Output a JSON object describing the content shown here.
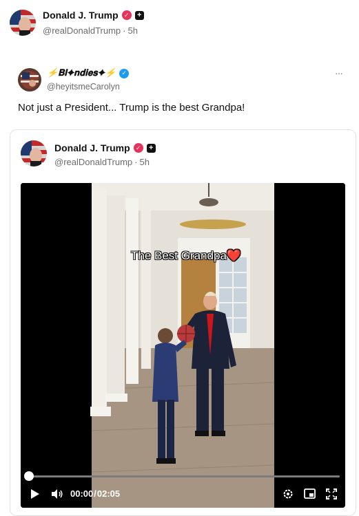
{
  "outer_post": {
    "author_name": "Donald J. Trump",
    "handle": "@realDonaldTrump",
    "time": "5h"
  },
  "repost": {
    "author_name": "⚡𝐁𝐥✦𝐧𝐝𝐢𝐞𝐬✦⚡",
    "handle": "@heyitsmeCarolyn",
    "text": "Not just a President... Trump is the best Grandpa!",
    "more_label": "···"
  },
  "quoted_post": {
    "author_name": "Donald J. Trump",
    "handle": "@realDonaldTrump",
    "time": "5h"
  },
  "video": {
    "overlay_caption": "The Best Grandpa❤️",
    "current_time": "00:00",
    "separator": "/",
    "duration": "02:05",
    "progress": 0.0
  },
  "icons": [
    "verified-pink-icon",
    "plus-square-icon",
    "verified-blue-icon",
    "more-icon",
    "play-icon",
    "volume-icon",
    "settings-icon",
    "pip-icon",
    "fullscreen-icon"
  ],
  "colors": {
    "verified_pink": "#e8315b",
    "verified_blue": "#1d9bf0",
    "video_bg": "#000000"
  }
}
